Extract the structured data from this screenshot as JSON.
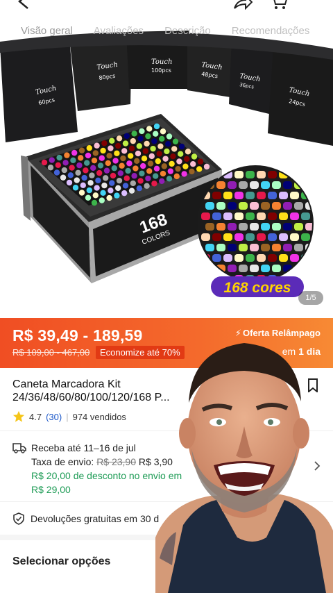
{
  "tabs": [
    "Visão geral",
    "Avaliações",
    "Descrição",
    "Recomendações"
  ],
  "hero": {
    "bag_labels": [
      "60pcs",
      "80pcs",
      "100pcs",
      "48pcs",
      "36pcs",
      "24pcs"
    ],
    "brand": "Touch",
    "box_number": "168",
    "box_label": "COLORS",
    "badge": "168 cores",
    "counter": "1/5"
  },
  "price": {
    "range": "R$ 39,49 - 189,59",
    "old_range": "R$ 109,00 - 467,00",
    "discount": "Economize até 70%",
    "flash": "Oferta Relâmpago",
    "ends_prefix": "em",
    "ends_value": "1 dia"
  },
  "product": {
    "title_line1": "Caneta Marcadora Kit",
    "title_line2": "24/36/48/60/80/100/120/168 P..."
  },
  "rating": {
    "score": "4.7",
    "count": "(30)",
    "sold": "974 vendidos"
  },
  "shipping": {
    "receive": "Receba até 11–16 de jul",
    "fee_label": "Taxa de envio:",
    "fee_old": "R$ 23,90",
    "fee_new": "R$ 3,90",
    "promo": "R$ 20,00 de desconto no envio em",
    "promo_min": "R$ 29,00"
  },
  "returns": {
    "label": "Devoluções gratuitas em 30 d"
  },
  "options": {
    "label": "Selecionar opções"
  },
  "colors": {
    "accent": "#f04e23",
    "link": "#1a56c8",
    "green": "#1d9b55",
    "badge": "#5b2bb8"
  }
}
